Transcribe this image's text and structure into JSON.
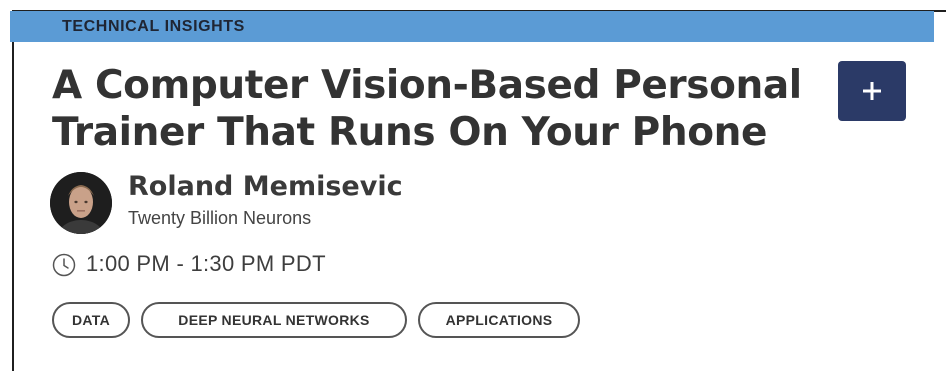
{
  "card": {
    "category": "TECHNICAL INSIGHTS",
    "title": "A Computer Vision-Based Personal Trainer That Runs On Your Phone",
    "add_button_icon": "plus-icon",
    "speaker": {
      "name": "Roland Memisevic",
      "organization": "Twenty Billion Neurons",
      "avatar_icon": "speaker-photo"
    },
    "time": "1:00 PM - 1:30 PM PDT",
    "time_icon": "clock-icon",
    "tags": [
      "DATA",
      "DEEP NEURAL NETWORKS",
      "APPLICATIONS"
    ]
  },
  "colors": {
    "category_band": "#5b9bd5",
    "add_button": "#2b3a67",
    "title_text": "#333333"
  }
}
